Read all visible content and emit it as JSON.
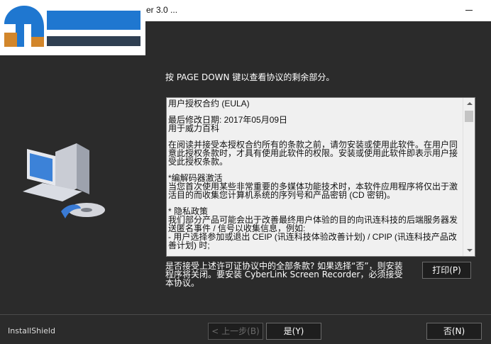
{
  "window": {
    "title": "er 3.0 ..."
  },
  "instruction": "按 PAGE DOWN 键以查看协议的剩余部分。",
  "eula": {
    "heading": "用户授权合约 (EULA)",
    "date_line": "最后修改日期: 2017年05月09日",
    "company": "用于威力百科",
    "paragraph1": "在阅读并接受本授权合约所有的条款之前，请勿安装或使用此软件。在用户同意此授权条款时，才具有使用此软件的权限。安装或使用此软件即表示用户接受此授权条款。",
    "codec_title": "*编解码器激活",
    "codec_body": "当您首次使用某些非常重要的多媒体功能技术时，本软件应用程序将仅出于激活目的而收集您计算机系统的序列号和产品密钥 (CD 密钥)。",
    "privacy_title": "* 隐私政策",
    "privacy_body": "我们部分产品可能会出于改善最终用户体验的目的向讯连科技的后端服务器发送匿名事件 / 信号以收集信息，例如:",
    "privacy_item": "- 用户选择参加或退出 CEIP (讯连科技体验改善计划) / CPIP (讯连科技产品改善计划) 时;"
  },
  "accept_question": "是否接受上述许可证协议中的全部条款? 如果选择“否”，则安装程序将关闭。要安装 CyberLink Screen Recorder，必须接受本协议。",
  "buttons": {
    "print": "打印(P)",
    "back": "< 上一步(B)",
    "yes": "是(Y)",
    "no": "否(N)"
  },
  "footer": {
    "brand": "InstallShield"
  },
  "colors": {
    "logo_blue": "#1f77d0",
    "logo_dark": "#2f3f52",
    "background": "#2b2b2b"
  },
  "icons": [
    "minimize-icon",
    "logo-icon",
    "computer-icon",
    "scroll-up-icon",
    "scroll-down-icon"
  ]
}
